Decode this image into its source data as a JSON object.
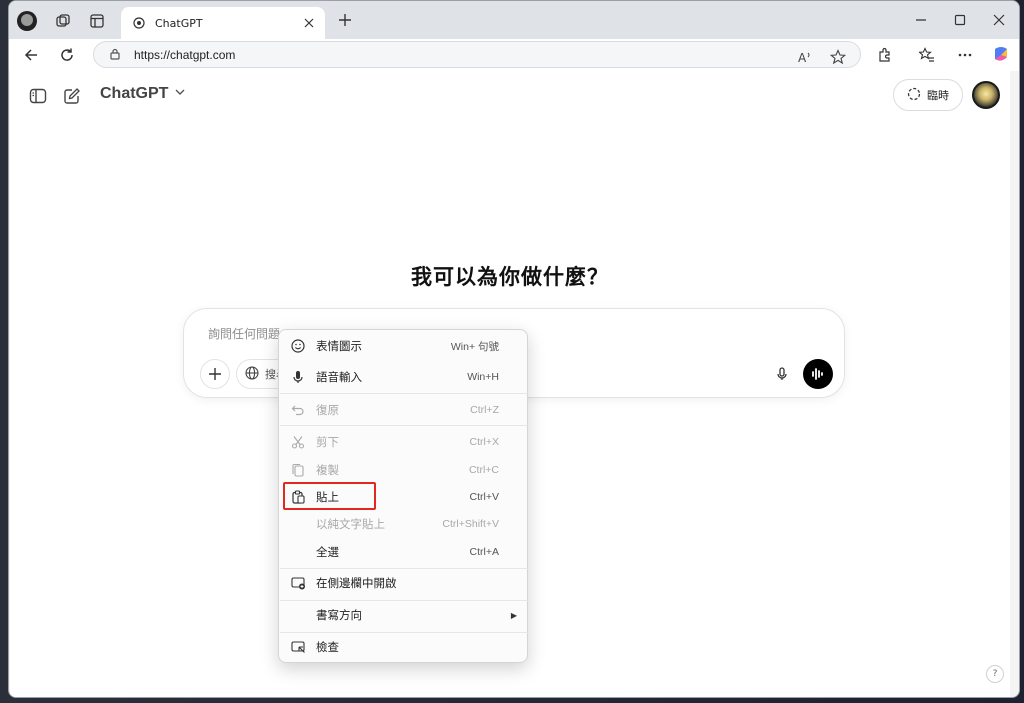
{
  "browser": {
    "tab_title": "ChatGPT",
    "url": "https://chatgpt.com"
  },
  "app": {
    "model_label": "ChatGPT",
    "temporary_label": "臨時",
    "headline": "我可以為你做什麼？",
    "composer_placeholder": "詢問任何問題",
    "search_label": "搜尋",
    "help_label": "?"
  },
  "context_menu": {
    "items": [
      {
        "label": "表情圖示",
        "shortcut": "Win+ 句號",
        "icon": "emoji-icon",
        "disabled": false
      },
      {
        "label": "語音輸入",
        "shortcut": "Win+H",
        "icon": "microphone-icon",
        "disabled": false
      },
      {
        "label": "復原",
        "shortcut": "Ctrl+Z",
        "icon": "undo-icon",
        "disabled": true
      },
      {
        "label": "剪下",
        "shortcut": "Ctrl+X",
        "icon": "scissors-icon",
        "disabled": true
      },
      {
        "label": "複製",
        "shortcut": "Ctrl+C",
        "icon": "copy-icon",
        "disabled": true
      },
      {
        "label": "貼上",
        "shortcut": "Ctrl+V",
        "icon": "paste-icon",
        "disabled": false
      },
      {
        "label": "以純文字貼上",
        "shortcut": "Ctrl+Shift+V",
        "icon": "",
        "disabled": true
      },
      {
        "label": "全選",
        "shortcut": "Ctrl+A",
        "icon": "",
        "disabled": false
      },
      {
        "label": "在側邊欄中開啟",
        "shortcut": "",
        "icon": "sidebar-open-icon",
        "disabled": false
      },
      {
        "label": "書寫方向",
        "shortcut": "",
        "icon": "",
        "disabled": false
      },
      {
        "label": "檢查",
        "shortcut": "",
        "icon": "inspect-icon",
        "disabled": false
      }
    ],
    "highlighted": "貼上"
  },
  "colors": {
    "highlight_box": "#e0291f",
    "voice_button": "#000000"
  }
}
